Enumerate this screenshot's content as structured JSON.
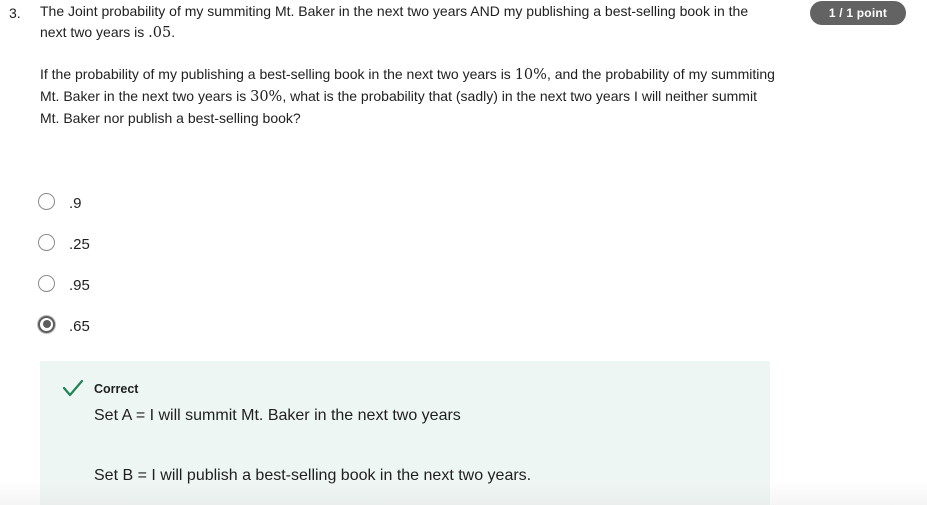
{
  "question": {
    "number": "3.",
    "para1_a": "The Joint probability of my summiting Mt. Baker in the next two years AND my publishing a best-selling book in the next two years is ",
    "para1_math": ".05",
    "para1_b": ".",
    "para2_a": "If the probability of my publishing a best-selling book in the next two years is ",
    "para2_math1": "10%",
    "para2_b": ", and the probability of my summiting Mt. Baker in the next two years is ",
    "para2_math2": "30%",
    "para2_c": ", what is the probability that (sadly) in the next two years I will neither summit Mt. Baker nor publish a best-selling book?"
  },
  "score_badge": "1 / 1 point",
  "options": [
    {
      "label": ".9",
      "selected": false
    },
    {
      "label": ".25",
      "selected": false
    },
    {
      "label": ".95",
      "selected": false
    },
    {
      "label": ".65",
      "selected": true
    }
  ],
  "feedback": {
    "status": "Correct",
    "icon": "check-icon",
    "line1": "Set A = I will summit Mt. Baker in the next two years",
    "line2": "Set B = I will publish a best-selling book in the next two years.",
    "icon_color": "#1f8354",
    "background": "#eef6f3"
  }
}
